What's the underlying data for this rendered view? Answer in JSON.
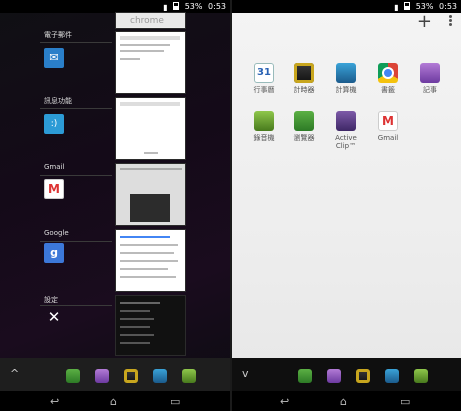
{
  "status": {
    "left": {
      "signal_icon": "signal-icon",
      "battery": "53%",
      "time": "0:53"
    },
    "right": {
      "signal_icon": "signal-icon",
      "battery": "53%",
      "time": "0:53"
    }
  },
  "recent_apps": [
    {
      "label": "電子郵件",
      "icon": "mail-icon"
    },
    {
      "label": "訊息功能",
      "icon": "message-icon"
    },
    {
      "label": "Gmail",
      "icon": "gmail-icon"
    },
    {
      "label": "Google",
      "icon": "google-icon"
    },
    {
      "label": "設定",
      "icon": "settings-icon"
    }
  ],
  "thumbnails": {
    "chrome_logo": "chrome"
  },
  "right_top": {
    "add_icon": "+",
    "menu_icon": "overflow-menu-icon"
  },
  "small_apps": [
    {
      "label": "行事曆",
      "icon": "calendar-icon",
      "glyph": "31"
    },
    {
      "label": "計時器",
      "icon": "timer-icon"
    },
    {
      "label": "計算機",
      "icon": "calculator-icon"
    },
    {
      "label": "書籤",
      "icon": "chrome-bookmarks-icon"
    },
    {
      "label": "記事",
      "icon": "notes-icon"
    },
    {
      "label": "錄音機",
      "icon": "voice-recorder-icon"
    },
    {
      "label": "瀏覽器",
      "icon": "browser-icon"
    },
    {
      "label": "Active Clip™",
      "icon": "active-clip-icon"
    },
    {
      "label": "Gmail",
      "icon": "gmail-icon",
      "glyph": "M"
    }
  ],
  "dock_left": {
    "toggle": "^"
  },
  "dock_right": {
    "toggle": "v"
  },
  "colors": {
    "accent_purple": "#6d3aa0",
    "accent_green": "#2d7a26",
    "accent_blue": "#1b5b8c"
  }
}
